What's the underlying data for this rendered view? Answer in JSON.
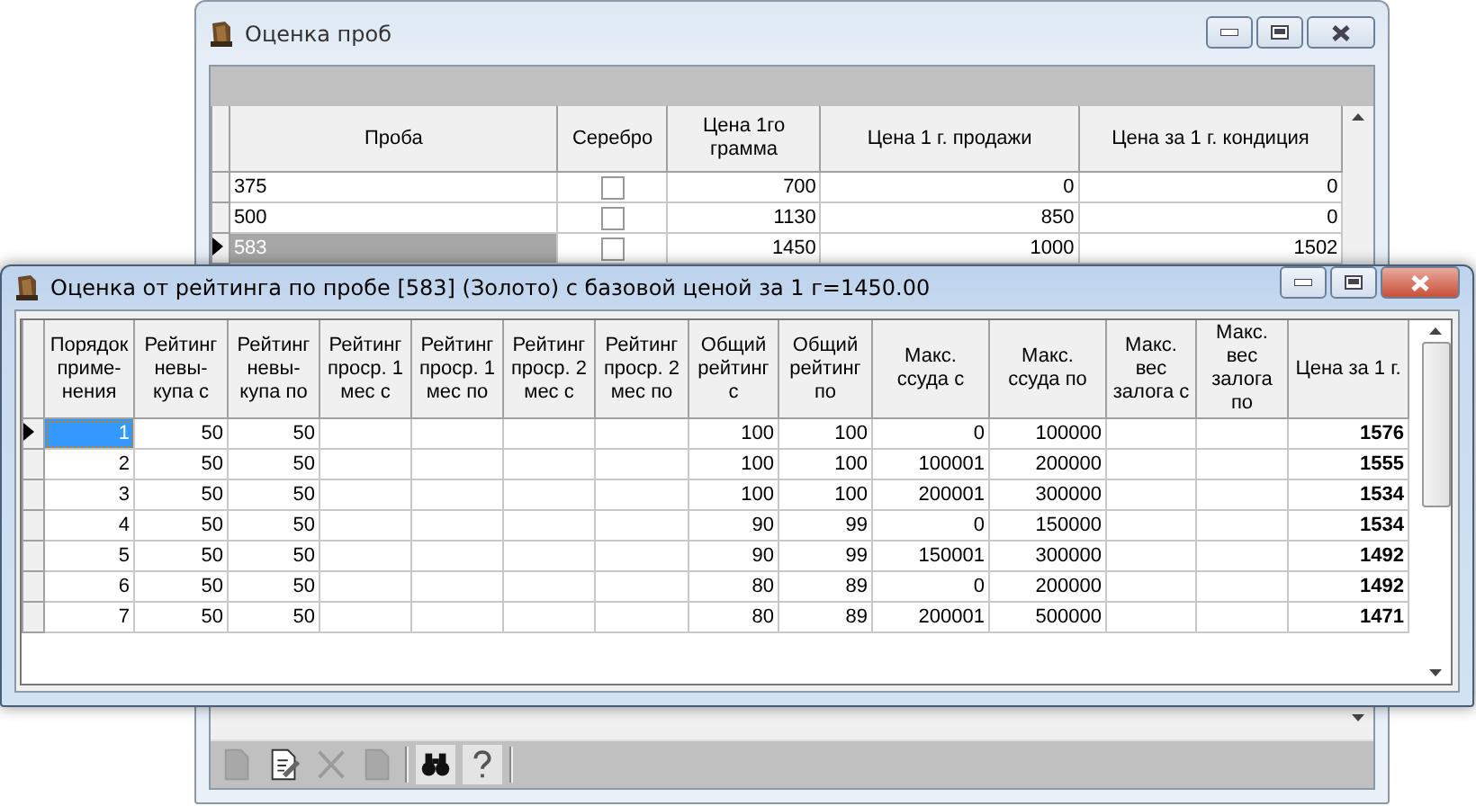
{
  "back_window": {
    "title": "Оценка проб",
    "columns": [
      "Проба",
      "Серебро",
      "Цена 1го\nграмма",
      "Цена 1 г. продажи",
      "Цена за 1 г. кондиция"
    ],
    "rows": [
      {
        "selected": false,
        "probe": "375",
        "silver": false,
        "gram_price": "700",
        "sale_price": "0",
        "condition_price": "0"
      },
      {
        "selected": false,
        "probe": "500",
        "silver": false,
        "gram_price": "1130",
        "sale_price": "850",
        "condition_price": "0"
      },
      {
        "selected": true,
        "probe": "583",
        "silver": false,
        "gram_price": "1450",
        "sale_price": "1000",
        "condition_price": "1502"
      }
    ]
  },
  "front_window": {
    "title": "Оценка от рейтинга по пробе [583] (Золото) с базовой ценой за 1 г=1450.00",
    "columns": [
      "Порядок\nприме-\nнения",
      "Рейтинг\nневы-\nкупа с",
      "Рейтинг\nневы-\nкупа по",
      "Рейтинг\nпроср. 1\nмес  с",
      "Рейтинг\nпроср. 1\nмес  по",
      "Рейтинг\nпроср. 2\nмес с",
      "Рейтинг\nпроср. 2\nмес по",
      "Общий\nрейтинг\nс",
      "Общий\nрейтинг\nпо",
      "Макс.\nссуда с",
      "Макс.\nссуда по",
      "Макс.\nвес\nзалога с",
      "Макс.\nвес\nзалога\nпо",
      "Цена за 1 г."
    ],
    "rows": [
      {
        "selected": true,
        "order": "1",
        "refusal_from": "50",
        "refusal_to": "50",
        "total_from": "100",
        "total_to": "100",
        "loan_from": "0",
        "loan_to": "100000",
        "price": "1576"
      },
      {
        "selected": false,
        "order": "2",
        "refusal_from": "50",
        "refusal_to": "50",
        "total_from": "100",
        "total_to": "100",
        "loan_from": "100001",
        "loan_to": "200000",
        "price": "1555"
      },
      {
        "selected": false,
        "order": "3",
        "refusal_from": "50",
        "refusal_to": "50",
        "total_from": "100",
        "total_to": "100",
        "loan_from": "200001",
        "loan_to": "300000",
        "price": "1534"
      },
      {
        "selected": false,
        "order": "4",
        "refusal_from": "50",
        "refusal_to": "50",
        "total_from": "90",
        "total_to": "99",
        "loan_from": "0",
        "loan_to": "150000",
        "price": "1534"
      },
      {
        "selected": false,
        "order": "5",
        "refusal_from": "50",
        "refusal_to": "50",
        "total_from": "90",
        "total_to": "99",
        "loan_from": "150001",
        "loan_to": "300000",
        "price": "1492"
      },
      {
        "selected": false,
        "order": "6",
        "refusal_from": "50",
        "refusal_to": "50",
        "total_from": "80",
        "total_to": "89",
        "loan_from": "0",
        "loan_to": "200000",
        "price": "1492"
      },
      {
        "selected": false,
        "order": "7",
        "refusal_from": "50",
        "refusal_to": "50",
        "total_from": "80",
        "total_to": "89",
        "loan_from": "200001",
        "loan_to": "500000",
        "price": "1471"
      }
    ]
  },
  "toolbar": [
    {
      "kind": "new",
      "disabled": true
    },
    {
      "kind": "edit",
      "disabled": false
    },
    {
      "kind": "delete",
      "disabled": true
    },
    {
      "kind": "copy",
      "disabled": true
    },
    {
      "kind": "separator"
    },
    {
      "kind": "find",
      "disabled": false
    },
    {
      "kind": "help",
      "disabled": false
    },
    {
      "kind": "separator"
    }
  ]
}
